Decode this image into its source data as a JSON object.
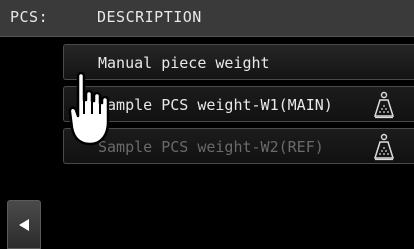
{
  "header": {
    "pcs_label": "PCS:",
    "description_label": "DESCRIPTION"
  },
  "menu": {
    "items": [
      {
        "label": "Manual piece weight",
        "enabled": true,
        "icon": ""
      },
      {
        "label": "Sample PCS weight-W1(MAIN)",
        "enabled": true,
        "icon": "weight-icon"
      },
      {
        "label": "Sample PCS weight-W2(REF)",
        "enabled": false,
        "icon": "weight-icon"
      }
    ]
  },
  "footer": {
    "back_icon": "left-arrow-icon"
  },
  "colors": {
    "header_bg": "#3a3a3a",
    "text": "#e8e8e8",
    "disabled_text": "#6a6a6a",
    "background": "#000000"
  }
}
